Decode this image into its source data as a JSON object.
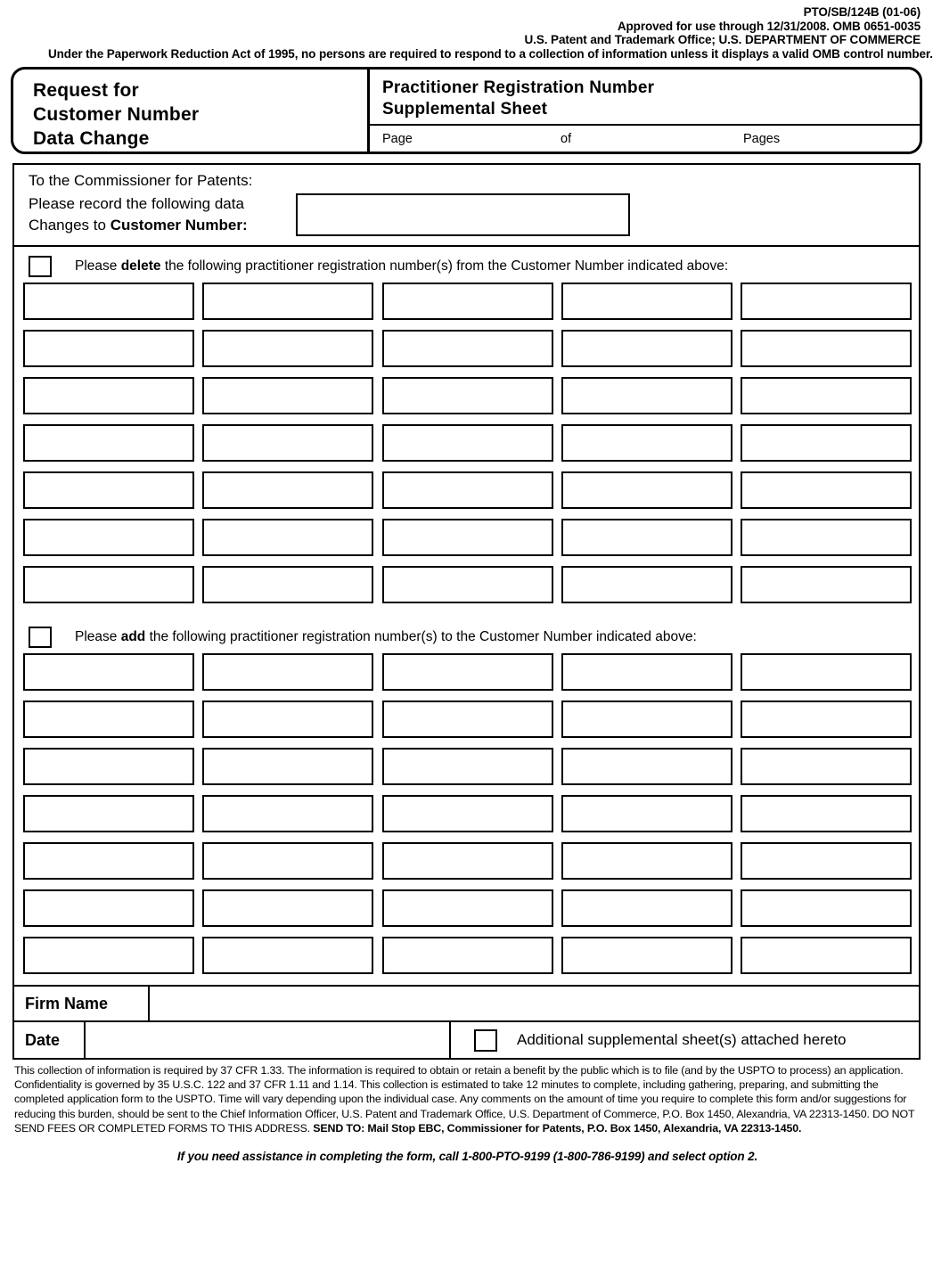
{
  "agency_header": {
    "form_number": "PTO/SB/124B (01-06)",
    "approved": "Approved for use through 12/31/2008. OMB 0651-0035",
    "office": "U.S. Patent and Trademark Office; U.S. DEPARTMENT OF COMMERCE",
    "paperwork_notice": "Under the Paperwork Reduction Act of 1995, no persons are required to respond to a collection of information unless it displays a valid OMB control number."
  },
  "title_box": {
    "left_line1": "Request for",
    "left_line2": "Customer Number",
    "left_line3": "Data Change",
    "right_line1": "Practitioner Registration Number",
    "right_line2": "Supplemental Sheet",
    "page_label": "Page",
    "of_label": "of",
    "pages_label": "Pages",
    "page_value": "",
    "pages_value": ""
  },
  "commissioner": {
    "heading": "To the Commissioner for Patents:",
    "record_line1": "Please record the following data",
    "record_line2_prefix": "Changes to ",
    "record_line2_bold": "Customer Number:",
    "customer_number_value": ""
  },
  "delete_section": {
    "checkbox_checked": false,
    "instruction_prefix": "Please ",
    "instruction_bold": "delete",
    "instruction_suffix": " the following practitioner registration number(s) from the Customer Number indicated above:",
    "rows": 7,
    "cols": 5,
    "values": [
      [
        "",
        "",
        "",
        "",
        ""
      ],
      [
        "",
        "",
        "",
        "",
        ""
      ],
      [
        "",
        "",
        "",
        "",
        ""
      ],
      [
        "",
        "",
        "",
        "",
        ""
      ],
      [
        "",
        "",
        "",
        "",
        ""
      ],
      [
        "",
        "",
        "",
        "",
        ""
      ],
      [
        "",
        "",
        "",
        "",
        ""
      ]
    ]
  },
  "add_section": {
    "checkbox_checked": false,
    "instruction_prefix": "Please ",
    "instruction_bold": "add",
    "instruction_suffix": " the following practitioner registration number(s) to the Customer Number indicated above:",
    "rows": 7,
    "cols": 5,
    "values": [
      [
        "",
        "",
        "",
        "",
        ""
      ],
      [
        "",
        "",
        "",
        "",
        ""
      ],
      [
        "",
        "",
        "",
        "",
        ""
      ],
      [
        "",
        "",
        "",
        "",
        ""
      ],
      [
        "",
        "",
        "",
        "",
        ""
      ],
      [
        "",
        "",
        "",
        "",
        ""
      ],
      [
        "",
        "",
        "",
        "",
        ""
      ]
    ]
  },
  "signature_block": {
    "firm_name_label": "Firm Name",
    "firm_name_value": "",
    "date_label": "Date",
    "date_value": "",
    "additional_checkbox_checked": false,
    "additional_label": "Additional supplemental sheet(s) attached hereto"
  },
  "footer": {
    "paragraph_plain_1": "This collection of information is required by 37 CFR 1.33.  The information is required to obtain or retain a benefit by the public which is to file (and by the USPTO to process) an application.  Confidentiality is governed by 35 U.S.C. 122 and 37 CFR 1.11 and 1.14.  This collection is estimated to take 12 minutes to complete, including gathering, preparing, and submitting the completed application form to the USPTO.  Time will vary depending upon the individual case.  Any comments on the amount of time you require to complete this form and/or suggestions for reducing this burden, should be sent to the Chief Information Officer, U.S. Patent and Trademark Office, U.S. Department of Commerce, P.O. Box 1450, Alexandria, VA 22313-1450.  DO NOT SEND FEES OR COMPLETED FORMS TO THIS ADDRESS. ",
    "send_to_bold": "SEND TO:  Mail Stop EBC, Commissioner for Patents, P.O. Box 1450, Alexandria, VA 22313-1450.",
    "assistance": "If you need assistance in completing the form, call 1-800-PTO-9199 (1-800-786-9199) and select option 2."
  }
}
